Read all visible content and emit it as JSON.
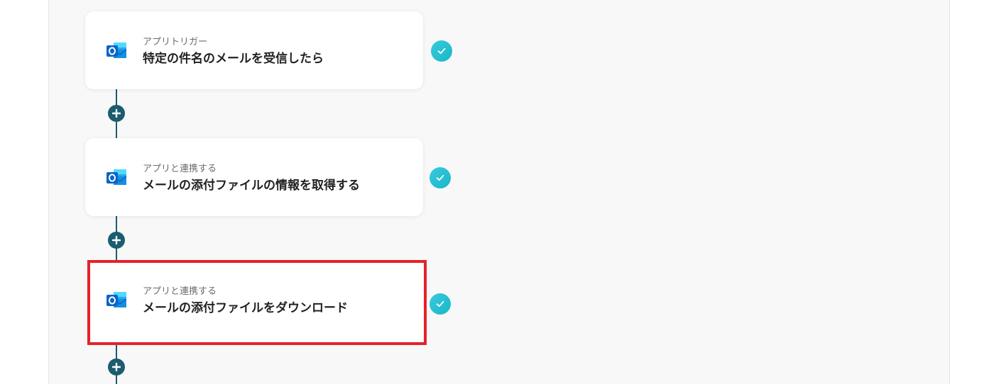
{
  "flow": {
    "steps": [
      {
        "kind": "アプリトリガー",
        "title": "特定の件名のメールを受信したら",
        "app_icon": "outlook-icon",
        "status": "complete"
      },
      {
        "kind": "アプリと連携する",
        "title": "メールの添付ファイルの情報を取得する",
        "app_icon": "outlook-icon",
        "status": "complete"
      },
      {
        "kind": "アプリと連携する",
        "title": "メールの添付ファイルをダウンロード",
        "app_icon": "outlook-icon",
        "status": "complete",
        "highlighted": true
      }
    ],
    "add_button_icon": "plus-icon",
    "status_icon": "check-icon"
  },
  "colors": {
    "connector": "#1b5c6e",
    "check": "#22bdd0",
    "highlight": "#e5222a",
    "outlook_blue": "#0a64c9"
  }
}
